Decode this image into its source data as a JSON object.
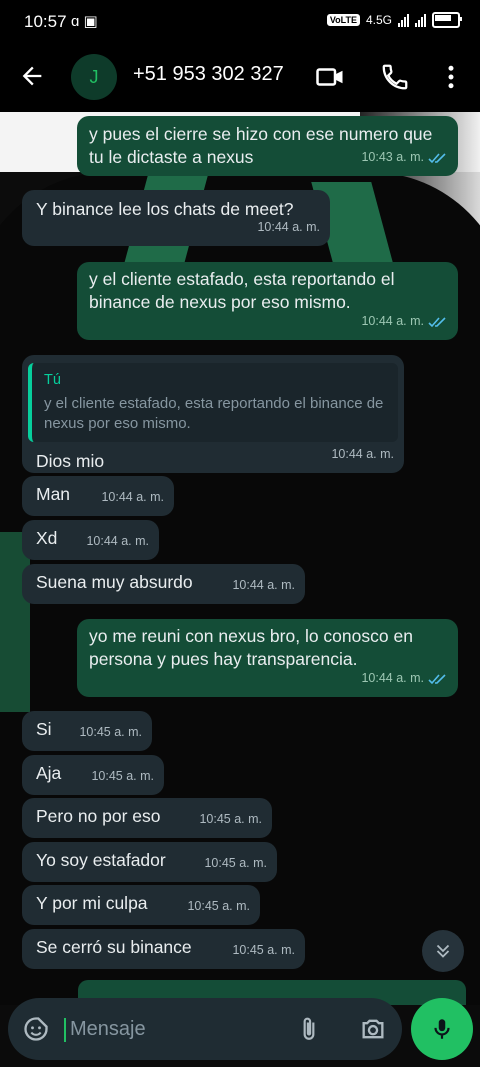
{
  "status_bar": {
    "time": "10:57",
    "network": "4.5G"
  },
  "header": {
    "avatar_initial": "J",
    "contact": "+51 953 302 327"
  },
  "messages": [
    {
      "dir": "out",
      "text": "y pues el cierre se hizo con ese numero que tu le dictaste a nexus",
      "time": "10:43 a. m."
    },
    {
      "dir": "in",
      "text": "Y binance lee los chats de meet?",
      "time": "10:44 a. m."
    },
    {
      "dir": "out",
      "text": "y el cliente estafado, esta reportando el binance de nexus por eso mismo.",
      "time": "10:44 a. m."
    },
    {
      "dir": "in",
      "quote_author": "Tú",
      "quote_text": "y el cliente estafado, esta reportando el binance de nexus por eso mismo.",
      "text": "Dios mio",
      "time": "10:44 a. m."
    },
    {
      "dir": "in",
      "text": "Man",
      "time": "10:44 a. m."
    },
    {
      "dir": "in",
      "text": "Xd",
      "time": "10:44 a. m."
    },
    {
      "dir": "in",
      "text": "Suena muy absurdo",
      "time": "10:44 a. m."
    },
    {
      "dir": "out",
      "text": "yo me reuni con nexus bro, lo conosco en persona y pues hay transparencia.",
      "time": "10:44 a. m."
    },
    {
      "dir": "in",
      "text": "Si",
      "time": "10:45 a. m."
    },
    {
      "dir": "in",
      "text": "Aja",
      "time": "10:45 a. m."
    },
    {
      "dir": "in",
      "text": "Pero no por eso",
      "time": "10:45 a. m."
    },
    {
      "dir": "in",
      "text": "Yo soy estafador",
      "time": "10:45 a. m."
    },
    {
      "dir": "in",
      "text": "Y por mi culpa",
      "time": "10:45 a. m."
    },
    {
      "dir": "in",
      "text": "Se cerró su binance",
      "time": "10:45 a. m."
    }
  ],
  "composer": {
    "placeholder": "Mensaje"
  },
  "colors": {
    "accent": "#21c063",
    "outgoing": "#144d37",
    "incoming": "#202c33",
    "read_ticks": "#53bdeb"
  }
}
